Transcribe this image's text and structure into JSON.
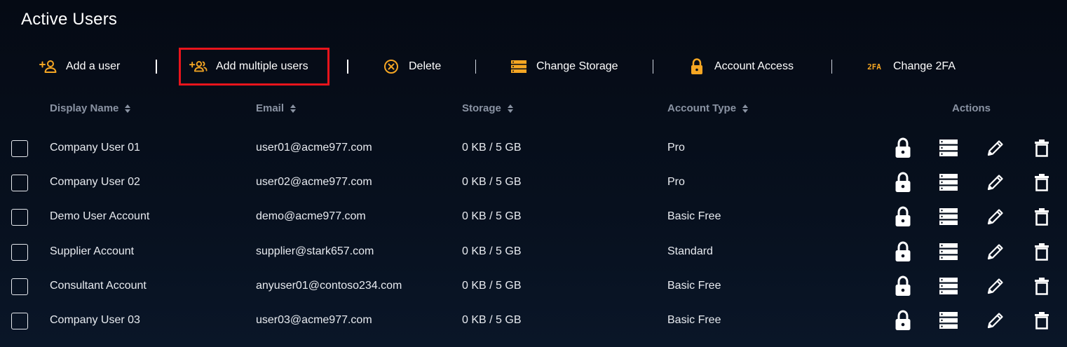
{
  "page": {
    "title": "Active Users"
  },
  "toolbar": {
    "add_user": "Add a user",
    "add_multiple": "Add multiple users",
    "delete": "Delete",
    "change_storage": "Change Storage",
    "account_access": "Account Access",
    "change_2fa": "Change 2FA",
    "twofa_icon_text": "2FA"
  },
  "table": {
    "headers": {
      "display_name": "Display Name",
      "email": "Email",
      "storage": "Storage",
      "account_type": "Account Type",
      "actions": "Actions"
    },
    "rows": [
      {
        "name": "Company User 01",
        "email": "user01@acme977.com",
        "storage": "0 KB / 5 GB",
        "type": "Pro"
      },
      {
        "name": "Company User 02",
        "email": "user02@acme977.com",
        "storage": "0 KB / 5 GB",
        "type": "Pro"
      },
      {
        "name": "Demo User Account",
        "email": "demo@acme977.com",
        "storage": "0 KB / 5 GB",
        "type": "Basic Free"
      },
      {
        "name": "Supplier Account",
        "email": "supplier@stark657.com",
        "storage": "0 KB / 5 GB",
        "type": "Standard"
      },
      {
        "name": "Consultant Account",
        "email": "anyuser01@contoso234.com",
        "storage": "0 KB / 5 GB",
        "type": "Basic Free"
      },
      {
        "name": "Company User 03",
        "email": "user03@acme977.com",
        "storage": "0 KB / 5 GB",
        "type": "Basic Free"
      }
    ]
  },
  "colors": {
    "accent": "#f5a623",
    "highlight_border": "#e8141c",
    "header_text": "#8a93a3",
    "background": "#07101e"
  },
  "icons": {
    "toolbar": [
      "add-user-icon",
      "add-multiple-users-icon",
      "delete-circle-icon",
      "storage-icon",
      "lock-icon",
      "twofa-icon"
    ],
    "row_actions": [
      "lock-icon",
      "storage-icon",
      "pencil-icon",
      "trash-icon"
    ]
  }
}
